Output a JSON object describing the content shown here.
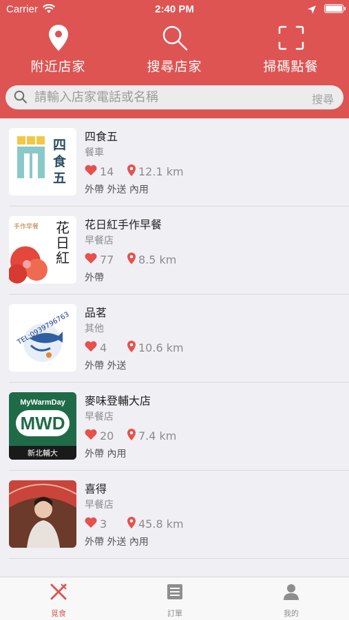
{
  "statusbar": {
    "carrier": "Carrier",
    "time": "2:40 PM"
  },
  "nav": [
    {
      "label": "附近店家",
      "icon": "location-pin-icon"
    },
    {
      "label": "搜尋店家",
      "icon": "search-icon"
    },
    {
      "label": "掃碼點餐",
      "icon": "scan-frame-icon"
    }
  ],
  "search": {
    "placeholder": "請輸入店家電話或名稱",
    "button": "搜尋"
  },
  "stores": [
    {
      "name": "四食五",
      "category": "餐車",
      "likes": "14",
      "distance": "12.1 km",
      "tags": "外帶 外送 內用",
      "logo_text": "四食五"
    },
    {
      "name": "花日紅手作早餐",
      "category": "早餐店",
      "likes": "77",
      "distance": "8.5 km",
      "tags": "外帶",
      "logo_text": "花日紅",
      "logo_subtext": "手作早餐"
    },
    {
      "name": "品茗",
      "category": "其他",
      "likes": "4",
      "distance": "10.6 km",
      "tags": "外帶 外送",
      "logo_text": "TEL:0939796763"
    },
    {
      "name": "麥味登輔大店",
      "category": "早餐店",
      "likes": "20",
      "distance": "7.4 km",
      "tags": "外帶 內用",
      "logo_text": "MWD",
      "logo_top": "MyWarmDay",
      "logo_bottom": "新北輔大"
    },
    {
      "name": "喜得",
      "category": "早餐店",
      "likes": "3",
      "distance": "45.8 km",
      "tags": "外帶 外送 內用"
    }
  ],
  "tabs": [
    {
      "label": "覓食",
      "icon": "fork-knife-icon",
      "active": true
    },
    {
      "label": "訂單",
      "icon": "list-icon",
      "active": false
    },
    {
      "label": "我的",
      "icon": "person-icon",
      "active": false
    }
  ],
  "colors": {
    "accent": "#de5453",
    "heart": "#e8504b",
    "pin": "#e8504b"
  }
}
